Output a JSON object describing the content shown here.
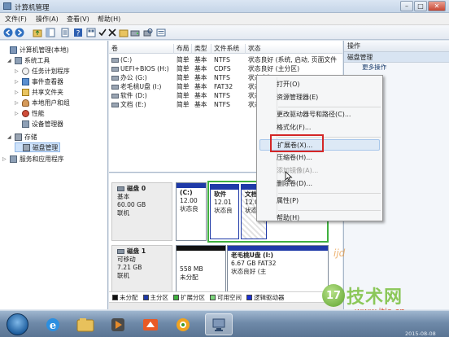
{
  "window": {
    "title": "计算机管理",
    "min": "–",
    "max": "□",
    "close": "✕"
  },
  "menu": [
    {
      "label": "文件(F)"
    },
    {
      "label": "操作(A)"
    },
    {
      "label": "查看(V)"
    },
    {
      "label": "帮助(H)"
    }
  ],
  "tree": [
    {
      "label": "计算机管理(本地)",
      "indent": 0,
      "arrow": "",
      "icon": "computer-icon"
    },
    {
      "label": "系统工具",
      "indent": 1,
      "arrow": "◢",
      "icon": "tools-icon"
    },
    {
      "label": "任务计划程序",
      "indent": 2,
      "arrow": "▷",
      "icon": "clock-icon"
    },
    {
      "label": "事件查看器",
      "indent": 2,
      "arrow": "▷",
      "icon": "event-icon"
    },
    {
      "label": "共享文件夹",
      "indent": 2,
      "arrow": "▷",
      "icon": "folder-icon"
    },
    {
      "label": "本地用户和组",
      "indent": 2,
      "arrow": "▷",
      "icon": "users-icon"
    },
    {
      "label": "性能",
      "indent": 2,
      "arrow": "▷",
      "icon": "perf-icon"
    },
    {
      "label": "设备管理器",
      "indent": 2,
      "arrow": "",
      "icon": "device-icon"
    },
    {
      "label": "存储",
      "indent": 1,
      "arrow": "◢",
      "icon": "storage-icon"
    },
    {
      "label": "磁盘管理",
      "indent": 2,
      "arrow": "",
      "icon": "disk-icon",
      "selected": true
    },
    {
      "label": "服务和应用程序",
      "indent": 1,
      "arrow": "▷",
      "icon": "services-icon"
    }
  ],
  "list": {
    "columns": [
      "卷",
      "布局",
      "类型",
      "文件系统",
      "状态"
    ],
    "rows": [
      {
        "vol": "(C:)",
        "layout": "简单",
        "type": "基本",
        "fs": "NTFS",
        "status": "状态良好 (系统, 启动, 页面文件"
      },
      {
        "vol": "UEFI+BIOS (H:)",
        "layout": "简单",
        "type": "基本",
        "fs": "CDFS",
        "status": "状态良好 (主分区)"
      },
      {
        "vol": "办公 (G:)",
        "layout": "简单",
        "type": "基本",
        "fs": "NTFS",
        "status": "状态良好"
      },
      {
        "vol": "老毛桃U盘 (I:)",
        "layout": "简单",
        "type": "基本",
        "fs": "FAT32",
        "status": "状态良好"
      },
      {
        "vol": "软件 (D:)",
        "layout": "简单",
        "type": "基本",
        "fs": "NTFS",
        "status": "状态良好"
      },
      {
        "vol": "文档 (E:)",
        "layout": "简单",
        "type": "基本",
        "fs": "NTFS",
        "status": "状态良好"
      }
    ]
  },
  "disks": [
    {
      "name": "磁盘 0",
      "type": "基本",
      "size": "60.00 GB",
      "state": "联机",
      "partitions": [
        {
          "title": "(C:)",
          "line1": "12.00",
          "line2": "状态良",
          "color": "#1f3aa8"
        },
        {
          "title": "软件",
          "line1": "12.01",
          "line2": "状态良",
          "color": "#1f3aa8"
        },
        {
          "title": "文档",
          "line1": "12.01",
          "line2": "状态良",
          "color": "#1f3aa8"
        }
      ]
    },
    {
      "name": "磁盘 1",
      "type": "可移动",
      "size": "7.21 GB",
      "state": "联机",
      "partitions": [
        {
          "title": "",
          "line1": "558 MB",
          "line2": "未分配",
          "color": "#111111"
        },
        {
          "title": "老毛桃U盘 (I:)",
          "line1": "6.67 GB FAT32",
          "line2": "状态良好 (主",
          "color": "#1f3aa8"
        }
      ]
    }
  ],
  "legend": [
    {
      "label": "未分配",
      "color": "#111111"
    },
    {
      "label": "主分区",
      "color": "#1f3aa8"
    },
    {
      "label": "扩展分区",
      "color": "#3fb03f"
    },
    {
      "label": "可用空间",
      "color": "#7cd67c"
    },
    {
      "label": "逻辑驱动器",
      "color": "#1b2fd6"
    }
  ],
  "actions": {
    "header": "操作",
    "section": "磁盘管理",
    "item": "更多操作"
  },
  "context_menu": [
    {
      "label": "打开(O)",
      "disabled": false
    },
    {
      "label": "资源管理器(E)",
      "disabled": false
    },
    {
      "sep": true
    },
    {
      "label": "更改驱动器号和路径(C)...",
      "disabled": false
    },
    {
      "label": "格式化(F)...",
      "disabled": false
    },
    {
      "sep": true
    },
    {
      "label": "扩展卷(X)...",
      "disabled": false,
      "hover": true
    },
    {
      "label": "压缩卷(H)...",
      "disabled": false
    },
    {
      "label": "添加镜像(A)...",
      "disabled": true
    },
    {
      "label": "删除卷(D)...",
      "disabled": false
    },
    {
      "sep": true
    },
    {
      "label": "属性(P)",
      "disabled": false
    },
    {
      "sep": true
    },
    {
      "label": "帮助(H)",
      "disabled": false
    }
  ],
  "watermark": {
    "logo": "17",
    "brand": "技术网",
    "url": "www.itjs.cn",
    "date": "2015-08-08",
    "ijd": "ijd"
  },
  "colors": {
    "highlight_box": "#d42626",
    "selection": "#cfe3fb"
  }
}
